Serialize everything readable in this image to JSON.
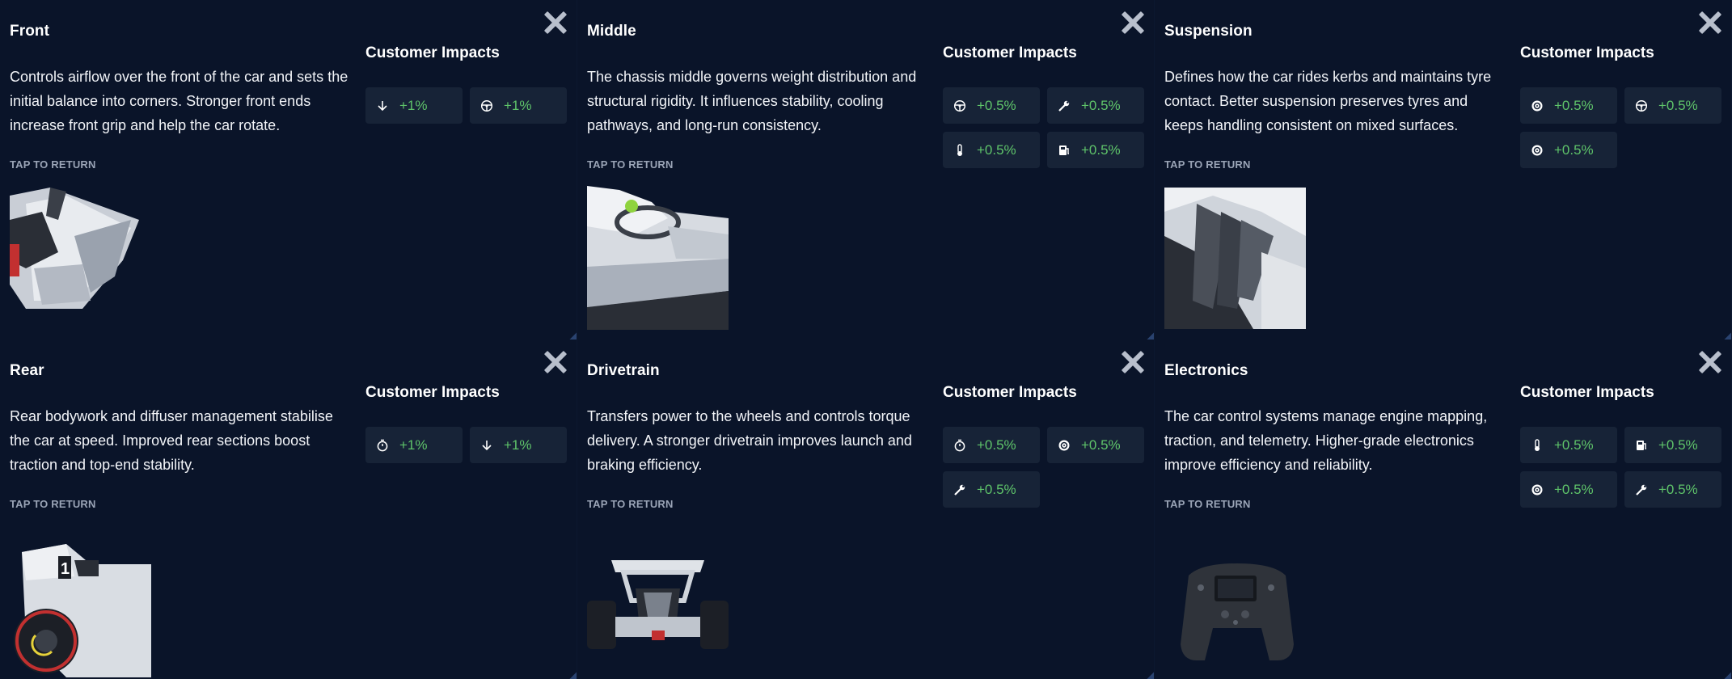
{
  "impacts_heading": "Customer Impacts",
  "tap_label": "TAP TO RETURN",
  "colors": {
    "background": "#0a1429",
    "chip": "#172337",
    "positive": "#5fc46a",
    "muted": "#9aa4b6"
  },
  "cards": [
    {
      "title": "Front",
      "description": "Controls airflow over the front of the car and sets the initial balance into corners. Stronger front ends increase front grip and help the car rotate.",
      "impacts": [
        {
          "icon": "downforce-arrow-icon",
          "value": "+1%"
        },
        {
          "icon": "steering-wheel-icon",
          "value": "+1%"
        }
      ]
    },
    {
      "title": "Middle",
      "description": "The chassis middle governs weight distribution and structural rigidity. It influences stability, cooling pathways, and long-run consistency.",
      "impacts": [
        {
          "icon": "steering-wheel-icon",
          "value": "+0.5%"
        },
        {
          "icon": "wrench-icon",
          "value": "+0.5%"
        },
        {
          "icon": "thermometer-icon",
          "value": "+0.5%"
        },
        {
          "icon": "fuel-pump-icon",
          "value": "+0.5%"
        }
      ]
    },
    {
      "title": "Suspension",
      "description": "Defines how the car rides kerbs and maintains tyre contact. Better suspension preserves tyres and keeps handling consistent on mixed surfaces.",
      "impacts": [
        {
          "icon": "tyre-icon",
          "value": "+0.5%"
        },
        {
          "icon": "steering-wheel-icon",
          "value": "+0.5%"
        },
        {
          "icon": "tyre-icon",
          "value": "+0.5%"
        }
      ]
    },
    {
      "title": "Rear",
      "description": "Rear bodywork and diffuser management stabilise the car at speed. Improved rear sections boost traction and top-end stability.",
      "impacts": [
        {
          "icon": "stopwatch-icon",
          "value": "+1%"
        },
        {
          "icon": "downforce-arrow-icon",
          "value": "+1%"
        }
      ]
    },
    {
      "title": "Drivetrain",
      "description": "Transfers power to the wheels and controls torque delivery. A stronger drivetrain improves launch and braking efficiency.",
      "impacts": [
        {
          "icon": "stopwatch-icon",
          "value": "+0.5%"
        },
        {
          "icon": "tyre-icon",
          "value": "+0.5%"
        },
        {
          "icon": "wrench-icon",
          "value": "+0.5%"
        }
      ]
    },
    {
      "title": "Electronics",
      "description": "The car control systems manage engine mapping, traction, and telemetry. Higher-grade electronics improve efficiency and reliability.",
      "impacts": [
        {
          "icon": "thermometer-icon",
          "value": "+0.5%"
        },
        {
          "icon": "fuel-pump-icon",
          "value": "+0.5%"
        },
        {
          "icon": "tyre-icon",
          "value": "+0.5%"
        },
        {
          "icon": "wrench-icon",
          "value": "+0.5%"
        }
      ]
    }
  ]
}
